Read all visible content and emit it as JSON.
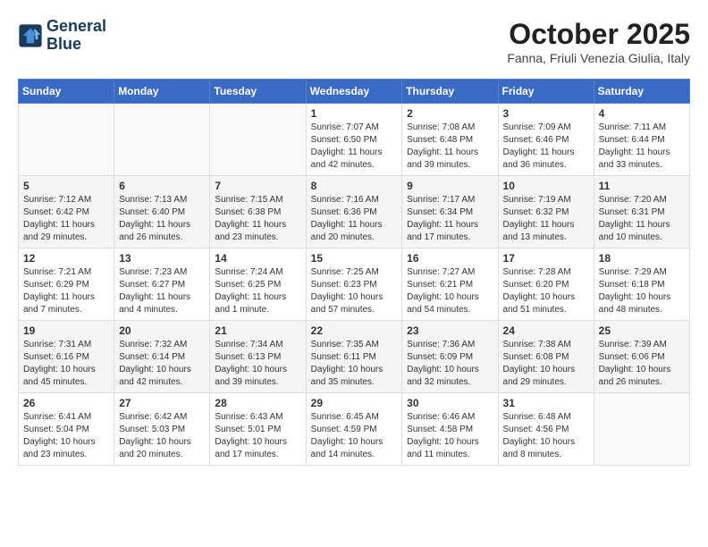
{
  "header": {
    "logo": {
      "line1": "General",
      "line2": "Blue"
    },
    "title": "October 2025",
    "location": "Fanna, Friuli Venezia Giulia, Italy"
  },
  "weekdays": [
    "Sunday",
    "Monday",
    "Tuesday",
    "Wednesday",
    "Thursday",
    "Friday",
    "Saturday"
  ],
  "weeks": [
    [
      {
        "day": "",
        "info": ""
      },
      {
        "day": "",
        "info": ""
      },
      {
        "day": "",
        "info": ""
      },
      {
        "day": "1",
        "info": "Sunrise: 7:07 AM\nSunset: 6:50 PM\nDaylight: 11 hours and 42 minutes."
      },
      {
        "day": "2",
        "info": "Sunrise: 7:08 AM\nSunset: 6:48 PM\nDaylight: 11 hours and 39 minutes."
      },
      {
        "day": "3",
        "info": "Sunrise: 7:09 AM\nSunset: 6:46 PM\nDaylight: 11 hours and 36 minutes."
      },
      {
        "day": "4",
        "info": "Sunrise: 7:11 AM\nSunset: 6:44 PM\nDaylight: 11 hours and 33 minutes."
      }
    ],
    [
      {
        "day": "5",
        "info": "Sunrise: 7:12 AM\nSunset: 6:42 PM\nDaylight: 11 hours and 29 minutes."
      },
      {
        "day": "6",
        "info": "Sunrise: 7:13 AM\nSunset: 6:40 PM\nDaylight: 11 hours and 26 minutes."
      },
      {
        "day": "7",
        "info": "Sunrise: 7:15 AM\nSunset: 6:38 PM\nDaylight: 11 hours and 23 minutes."
      },
      {
        "day": "8",
        "info": "Sunrise: 7:16 AM\nSunset: 6:36 PM\nDaylight: 11 hours and 20 minutes."
      },
      {
        "day": "9",
        "info": "Sunrise: 7:17 AM\nSunset: 6:34 PM\nDaylight: 11 hours and 17 minutes."
      },
      {
        "day": "10",
        "info": "Sunrise: 7:19 AM\nSunset: 6:32 PM\nDaylight: 11 hours and 13 minutes."
      },
      {
        "day": "11",
        "info": "Sunrise: 7:20 AM\nSunset: 6:31 PM\nDaylight: 11 hours and 10 minutes."
      }
    ],
    [
      {
        "day": "12",
        "info": "Sunrise: 7:21 AM\nSunset: 6:29 PM\nDaylight: 11 hours and 7 minutes."
      },
      {
        "day": "13",
        "info": "Sunrise: 7:23 AM\nSunset: 6:27 PM\nDaylight: 11 hours and 4 minutes."
      },
      {
        "day": "14",
        "info": "Sunrise: 7:24 AM\nSunset: 6:25 PM\nDaylight: 11 hours and 1 minute."
      },
      {
        "day": "15",
        "info": "Sunrise: 7:25 AM\nSunset: 6:23 PM\nDaylight: 10 hours and 57 minutes."
      },
      {
        "day": "16",
        "info": "Sunrise: 7:27 AM\nSunset: 6:21 PM\nDaylight: 10 hours and 54 minutes."
      },
      {
        "day": "17",
        "info": "Sunrise: 7:28 AM\nSunset: 6:20 PM\nDaylight: 10 hours and 51 minutes."
      },
      {
        "day": "18",
        "info": "Sunrise: 7:29 AM\nSunset: 6:18 PM\nDaylight: 10 hours and 48 minutes."
      }
    ],
    [
      {
        "day": "19",
        "info": "Sunrise: 7:31 AM\nSunset: 6:16 PM\nDaylight: 10 hours and 45 minutes."
      },
      {
        "day": "20",
        "info": "Sunrise: 7:32 AM\nSunset: 6:14 PM\nDaylight: 10 hours and 42 minutes."
      },
      {
        "day": "21",
        "info": "Sunrise: 7:34 AM\nSunset: 6:13 PM\nDaylight: 10 hours and 39 minutes."
      },
      {
        "day": "22",
        "info": "Sunrise: 7:35 AM\nSunset: 6:11 PM\nDaylight: 10 hours and 35 minutes."
      },
      {
        "day": "23",
        "info": "Sunrise: 7:36 AM\nSunset: 6:09 PM\nDaylight: 10 hours and 32 minutes."
      },
      {
        "day": "24",
        "info": "Sunrise: 7:38 AM\nSunset: 6:08 PM\nDaylight: 10 hours and 29 minutes."
      },
      {
        "day": "25",
        "info": "Sunrise: 7:39 AM\nSunset: 6:06 PM\nDaylight: 10 hours and 26 minutes."
      }
    ],
    [
      {
        "day": "26",
        "info": "Sunrise: 6:41 AM\nSunset: 5:04 PM\nDaylight: 10 hours and 23 minutes."
      },
      {
        "day": "27",
        "info": "Sunrise: 6:42 AM\nSunset: 5:03 PM\nDaylight: 10 hours and 20 minutes."
      },
      {
        "day": "28",
        "info": "Sunrise: 6:43 AM\nSunset: 5:01 PM\nDaylight: 10 hours and 17 minutes."
      },
      {
        "day": "29",
        "info": "Sunrise: 6:45 AM\nSunset: 4:59 PM\nDaylight: 10 hours and 14 minutes."
      },
      {
        "day": "30",
        "info": "Sunrise: 6:46 AM\nSunset: 4:58 PM\nDaylight: 10 hours and 11 minutes."
      },
      {
        "day": "31",
        "info": "Sunrise: 6:48 AM\nSunset: 4:56 PM\nDaylight: 10 hours and 8 minutes."
      },
      {
        "day": "",
        "info": ""
      }
    ]
  ]
}
